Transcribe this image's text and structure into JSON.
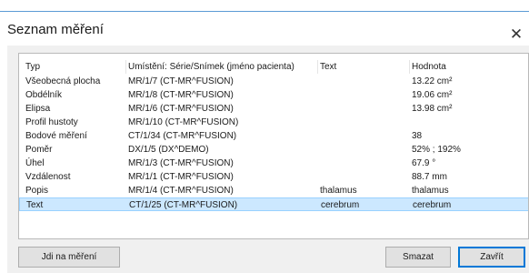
{
  "dialog": {
    "title": "Seznam měření",
    "close_glyph": "✕"
  },
  "table": {
    "columns": [
      "Typ",
      "Umístění: Série/Snímek (jméno pacienta)",
      "Text",
      "Hodnota"
    ],
    "rows": [
      [
        "Všeobecná plocha",
        "MR/1/7  (CT-MR^FUSION)",
        "",
        "13.22 cm²"
      ],
      [
        "Obdélník",
        "MR/1/8  (CT-MR^FUSION)",
        "",
        "19.06 cm²"
      ],
      [
        "Elipsa",
        "MR/1/6  (CT-MR^FUSION)",
        "",
        "13.98 cm²"
      ],
      [
        "Profil hustoty",
        "MR/1/10  (CT-MR^FUSION)",
        "",
        ""
      ],
      [
        "Bodové měření",
        "CT/1/34  (CT-MR^FUSION)",
        "",
        "38"
      ],
      [
        "Poměr",
        "DX/1/5  (DX^DEMO)",
        "",
        "52% ; 192%"
      ],
      [
        "Úhel",
        "MR/1/3  (CT-MR^FUSION)",
        "",
        "67.9 °"
      ],
      [
        "Vzdálenost",
        "MR/1/1  (CT-MR^FUSION)",
        "",
        "88.7 mm"
      ],
      [
        "Popis",
        "MR/1/4  (CT-MR^FUSION)",
        "thalamus",
        "thalamus"
      ],
      [
        "Text",
        "CT/1/25  (CT-MR^FUSION)",
        "cerebrum",
        "cerebrum"
      ]
    ],
    "selected_row_index": 9
  },
  "buttons": {
    "goto": "Jdi na měření",
    "delete": "Smazat",
    "close": "Zavřít"
  }
}
